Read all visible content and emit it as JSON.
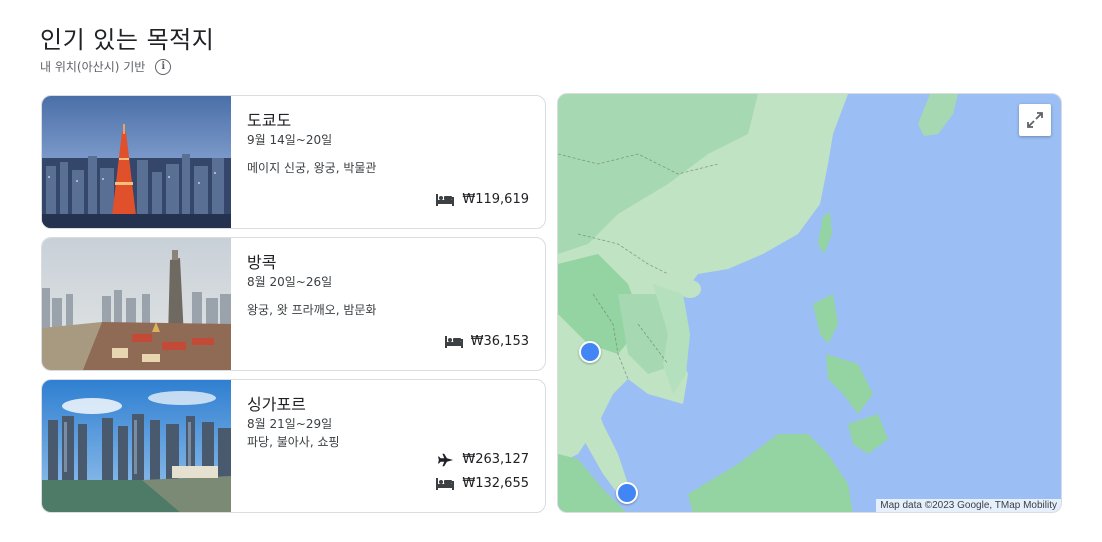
{
  "header": {
    "title": "인기 있는 목적지",
    "subtitle": "내 위치(아산시) 기반",
    "info_icon": "info-icon"
  },
  "destinations": [
    {
      "name": "도쿄도",
      "dates": "9월 14일~20일",
      "attractions": "메이지 신궁, 왕궁, 박물관",
      "prices": [
        {
          "icon": "hotel-icon",
          "value": "₩119,619"
        }
      ]
    },
    {
      "name": "방콕",
      "dates": "8월 20일~26일",
      "attractions": "왕궁, 왓 프라깨오, 밤문화",
      "prices": [
        {
          "icon": "hotel-icon",
          "value": "₩36,153"
        }
      ]
    },
    {
      "name": "싱가포르",
      "dates": "8월 21일~29일",
      "attractions": "파당, 불아사, 쇼핑",
      "prices": [
        {
          "icon": "flight-icon",
          "value": "₩263,127"
        },
        {
          "icon": "hotel-icon",
          "value": "₩132,655"
        }
      ]
    }
  ],
  "map": {
    "credit": "Map data ©2023 Google, TMap Mobility",
    "expand_icon": "expand-icon",
    "colors": {
      "water": "#9bbff4",
      "land": "#bfe3c3",
      "forest": "#94d3a2",
      "pin": "#4285f4"
    }
  }
}
